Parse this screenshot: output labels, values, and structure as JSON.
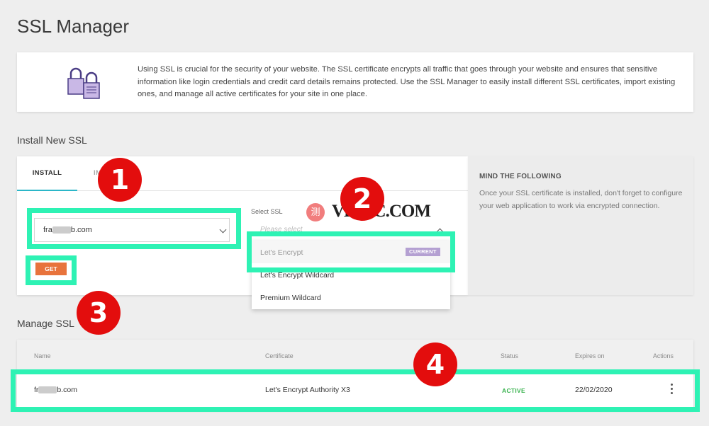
{
  "page": {
    "title": "SSL Manager"
  },
  "info": {
    "text": "Using SSL is crucial for the security of your website. The SSL certificate encrypts all traffic that goes through your website and ensures that sensitive information like login credentials and credit card details remains protected. Use the SSL Manager to easily install different SSL certificates, import existing ones, and manage all active certificates for your site in one place."
  },
  "install": {
    "section_title": "Install New SSL",
    "tabs": [
      {
        "label": "INSTALL"
      },
      {
        "label": "IMPORT"
      }
    ],
    "domain_prefix": "fra",
    "domain_suffix": "b.com",
    "get_label": "GET",
    "select_label": "Select SSL",
    "select_placeholder": "Please select",
    "options": [
      {
        "label": "Let's Encrypt",
        "badge": "CURRENT"
      },
      {
        "label": "Let's Encrypt Wildcard"
      },
      {
        "label": "Premium Wildcard"
      }
    ]
  },
  "mind": {
    "title": "MIND THE FOLLOWING",
    "text": "Once your SSL certificate is installed, don't forget to configure your web application to work via encrypted connection."
  },
  "manage": {
    "section_title": "Manage SSL",
    "columns": [
      "Name",
      "Certificate",
      "Status",
      "Expires on",
      "Actions"
    ],
    "rows": [
      {
        "name_prefix": "fr",
        "name_suffix": "b.com",
        "certificate": "Let's Encrypt Authority X3",
        "status": "ACTIVE",
        "expires": "22/02/2020"
      }
    ]
  },
  "callouts": [
    "1",
    "2",
    "3",
    "4"
  ],
  "watermark": {
    "glyph": "测",
    "text": "VEIDC.COM"
  },
  "colors": {
    "accent_tab": "#2bb6c8",
    "get_button": "#e8733c",
    "badge": "#b4a0d2",
    "active": "#37b24d",
    "highlight": "#2ef2b4",
    "callout": "#e30d0d"
  }
}
